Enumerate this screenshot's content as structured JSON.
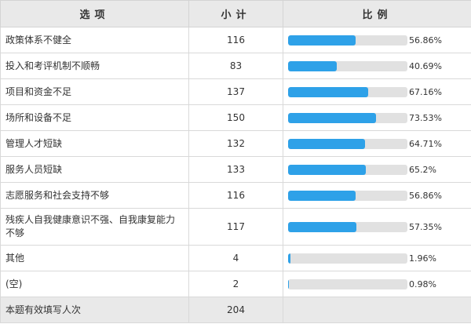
{
  "table": {
    "headers": {
      "option": "选项",
      "count": "小计",
      "ratio": "比例"
    },
    "rows": [
      {
        "option": "政策体系不健全",
        "count": "116",
        "percent_label": "56.86%",
        "percent": 56.86
      },
      {
        "option": "投入和考评机制不顺畅",
        "count": "83",
        "percent_label": "40.69%",
        "percent": 40.69
      },
      {
        "option": "项目和资金不足",
        "count": "137",
        "percent_label": "67.16%",
        "percent": 67.16
      },
      {
        "option": "场所和设备不足",
        "count": "150",
        "percent_label": "73.53%",
        "percent": 73.53
      },
      {
        "option": "管理人才短缺",
        "count": "132",
        "percent_label": "64.71%",
        "percent": 64.71
      },
      {
        "option": "服务人员短缺",
        "count": "133",
        "percent_label": "65.2%",
        "percent": 65.2
      },
      {
        "option": "志愿服务和社会支持不够",
        "count": "116",
        "percent_label": "56.86%",
        "percent": 56.86
      },
      {
        "option": "残疾人自我健康意识不强、自我康复能力不够",
        "count": "117",
        "percent_label": "57.35%",
        "percent": 57.35
      },
      {
        "option": "其他",
        "count": "4",
        "percent_label": "1.96%",
        "percent": 1.96
      },
      {
        "option": "(空)",
        "count": "2",
        "percent_label": "0.98%",
        "percent": 0.98
      }
    ],
    "summary": {
      "label": "本题有效填写人次",
      "count": "204"
    }
  },
  "colors": {
    "bar_fill": "#2ea1e8",
    "bar_track": "#e1e1e1",
    "header_bg": "#e9e9e9"
  }
}
